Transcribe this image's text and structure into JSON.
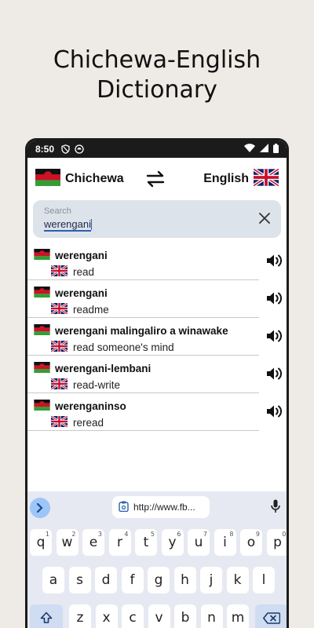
{
  "promo": {
    "line1": "Chichewa-English",
    "line2": "Dictionary"
  },
  "status_bar": {
    "time": "8:50"
  },
  "lang_bar": {
    "source": "Chichewa",
    "target": "English"
  },
  "search": {
    "placeholder": "Search",
    "value": "werengani"
  },
  "results": [
    {
      "term": "werengani",
      "translation": "read"
    },
    {
      "term": "werengani",
      "translation": "readme"
    },
    {
      "term": "werengani malingaliro a winawake",
      "translation": "read someone's mind"
    },
    {
      "term": "werengani-lembani",
      "translation": "read-write"
    },
    {
      "term": "werenganinso",
      "translation": "reread"
    }
  ],
  "keyboard": {
    "clipboard_suggestion": "http://www.fb...",
    "row1": [
      {
        "k": "q",
        "s": "1"
      },
      {
        "k": "w",
        "s": "2"
      },
      {
        "k": "e",
        "s": "3"
      },
      {
        "k": "r",
        "s": "4"
      },
      {
        "k": "t",
        "s": "5"
      },
      {
        "k": "y",
        "s": "6"
      },
      {
        "k": "u",
        "s": "7"
      },
      {
        "k": "i",
        "s": "8"
      },
      {
        "k": "o",
        "s": "9"
      },
      {
        "k": "p",
        "s": "0"
      }
    ],
    "row2": [
      "a",
      "s",
      "d",
      "f",
      "g",
      "h",
      "j",
      "k",
      "l"
    ],
    "row3": [
      "z",
      "x",
      "c",
      "v",
      "b",
      "n",
      "m"
    ]
  },
  "colors": {
    "accent": "#2e5fb0",
    "search_bg": "#dde3ea",
    "keyboard_bg": "#e6e9f1"
  }
}
